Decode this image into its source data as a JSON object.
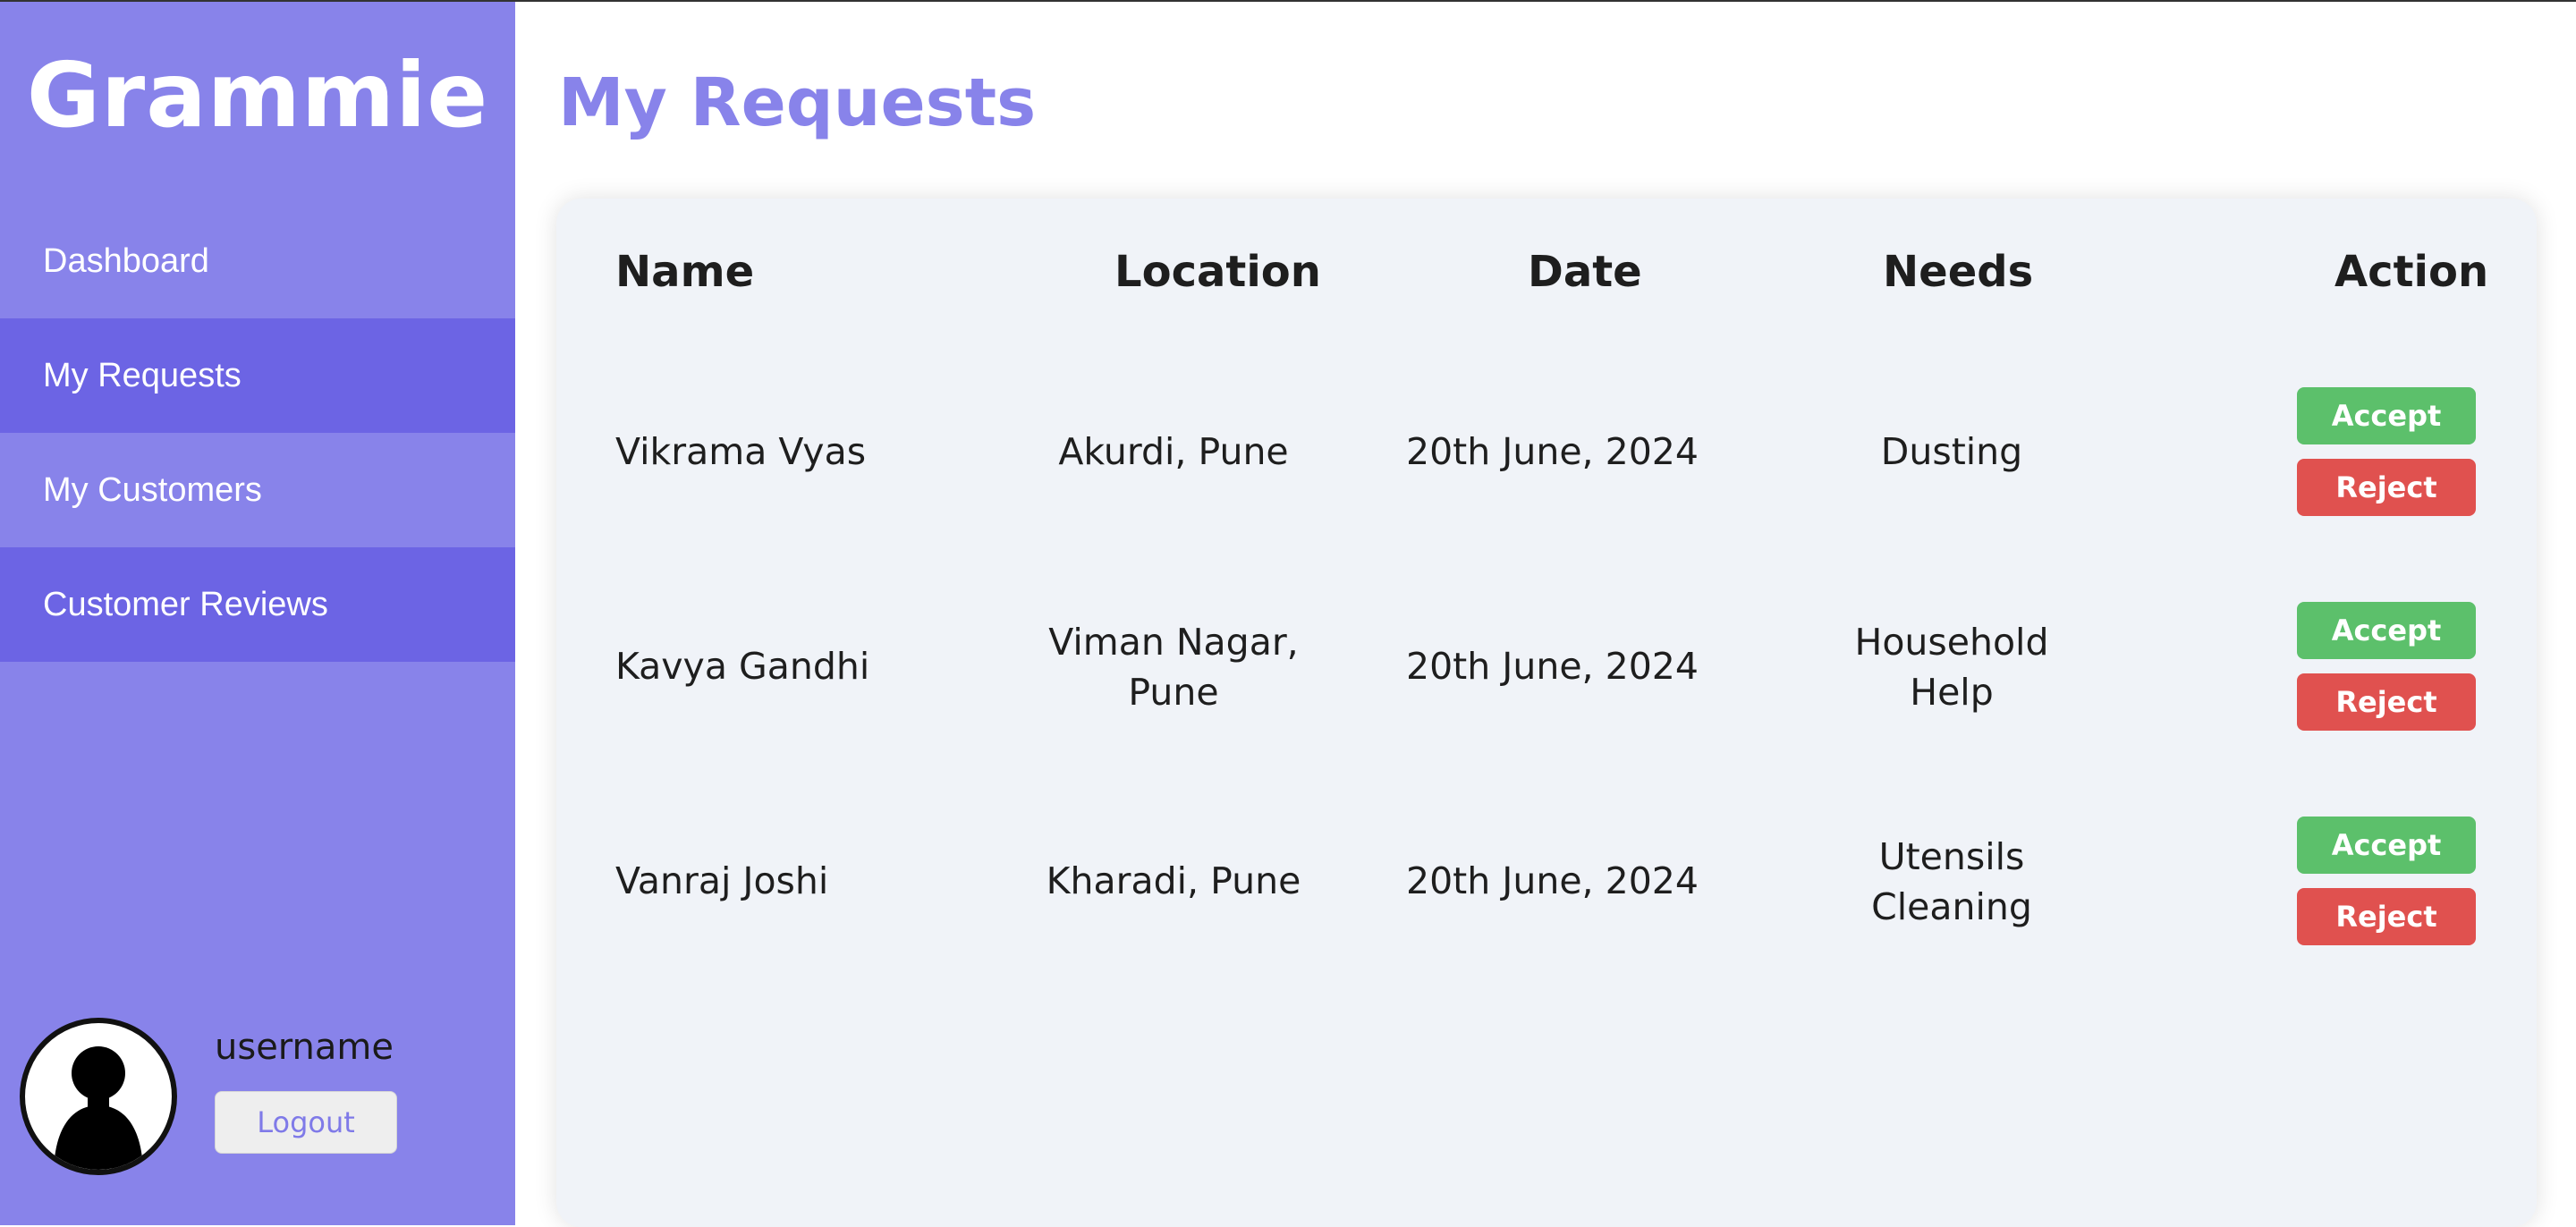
{
  "app": {
    "brand": "Grammie"
  },
  "sidebar": {
    "items": [
      {
        "label": "Dashboard"
      },
      {
        "label": "My Requests"
      },
      {
        "label": "My Customers"
      },
      {
        "label": "Customer Reviews"
      }
    ],
    "profile": {
      "username": "username",
      "logout_label": "Logout",
      "avatar_icon": "user-silhouette-icon"
    }
  },
  "main": {
    "title": "My Requests",
    "table": {
      "headers": {
        "name": "Name",
        "location": "Location",
        "date": "Date",
        "needs": "Needs",
        "action": "Action"
      },
      "rows": [
        {
          "name": "Vikrama Vyas",
          "location_line1": "Akurdi, Pune",
          "location_line2": "",
          "date": "20th June, 2024",
          "needs_line1": "Dusting",
          "needs_line2": "",
          "accept": "Accept",
          "reject": "Reject"
        },
        {
          "name": "Kavya Gandhi",
          "location_line1": "Viman Nagar,",
          "location_line2": "Pune",
          "date": "20th June, 2024",
          "needs_line1": "Household",
          "needs_line2": "Help",
          "accept": "Accept",
          "reject": "Reject"
        },
        {
          "name": "Vanraj Joshi",
          "location_line1": "Kharadi, Pune",
          "location_line2": "",
          "date": "20th June, 2024",
          "needs_line1": "Utensils",
          "needs_line2": "Cleaning",
          "accept": "Accept",
          "reject": "Reject"
        }
      ]
    }
  },
  "colors": {
    "sidebar": "#8883ea",
    "sidebar_active": "#6c64e4",
    "title": "#8883ea",
    "card": "#f0f3f8",
    "accept": "#5cc06b",
    "reject": "#e0514f"
  }
}
